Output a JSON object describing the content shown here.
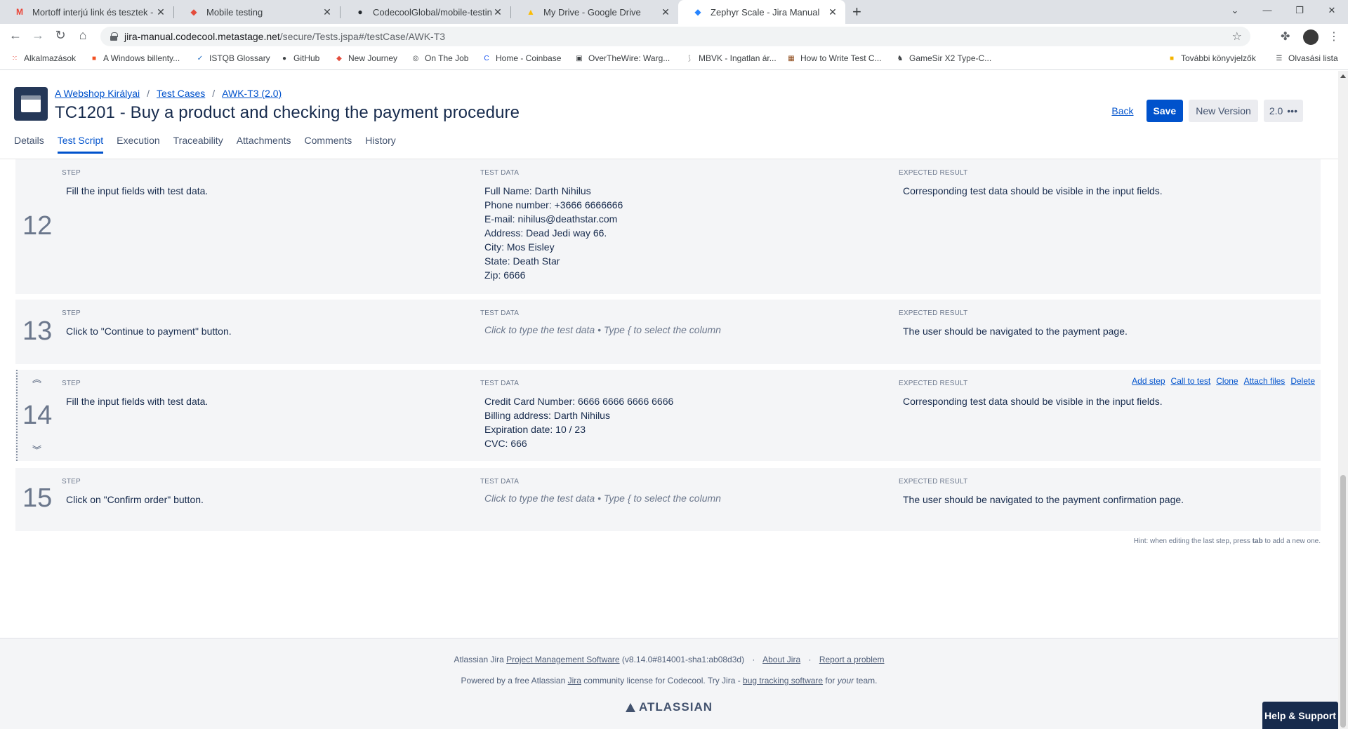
{
  "browser": {
    "tabs": [
      {
        "title": "Mortoff interjú link és tesztek - c",
        "icon": "gmail-icon"
      },
      {
        "title": "Mobile testing",
        "icon": "jira-icon"
      },
      {
        "title": "CodecoolGlobal/mobile-testing-",
        "icon": "github-icon"
      },
      {
        "title": "My Drive - Google Drive",
        "icon": "drive-icon"
      },
      {
        "title": "Zephyr Scale - Jira Manual",
        "icon": "jira-icon"
      }
    ],
    "new_tab": "+",
    "url_host": "jira-manual.codecool.metastage.net",
    "url_path": "/secure/Tests.jspa#/testCase/AWK-T3",
    "bookmarks": [
      "Alkalmazások",
      "A Windows billenty...",
      "ISTQB Glossary",
      "GitHub",
      "New Journey",
      "On The Job",
      "Home - Coinbase",
      "OverTheWire: Warg...",
      "MBVK - Ingatlan ár...",
      "How to Write Test C...",
      "GameSir X2 Type-C..."
    ],
    "other_bookmarks": "További könyvjelzők",
    "reading_list": "Olvasási lista"
  },
  "header": {
    "breadcrumbs": [
      "A Webshop Királyai",
      "Test Cases",
      "AWK-T3 (2.0)"
    ],
    "title": "TC1201 - Buy a product and checking the payment procedure",
    "back": "Back",
    "save": "Save",
    "new_version": "New Version",
    "version": "2.0",
    "tabs": [
      "Details",
      "Test Script",
      "Execution",
      "Traceability",
      "Attachments",
      "Comments",
      "History"
    ]
  },
  "labels": {
    "step": "STEP",
    "test_data": "TEST DATA",
    "expected": "EXPECTED RESULT",
    "placeholder": "Click to type the test data • Type { to select the column"
  },
  "steps": [
    {
      "num": "12",
      "step": "Fill the input fields with test data.",
      "data": "Full Name: Darth Nihilus\nPhone number: +3666 6666666\nE-mail: nihilus@deathstar.com\nAddress: Dead Jedi way 66.\nCity: Mos Eisley\nState: Death Star\nZip: 6666",
      "expected": "Corresponding test data should be visible in the input fields."
    },
    {
      "num": "13",
      "step": "Click to \"Continue to payment\" button.",
      "data": "",
      "expected": "The user should be navigated to the payment page."
    },
    {
      "num": "14",
      "step": "Fill the input fields with test data.",
      "data": "Credit Card Number: 6666 6666 6666 6666\nBilling address: Darth Nihilus\nExpiration date: 10 / 23\nCVC: 666",
      "expected": "Corresponding test data should be visible in the input fields."
    },
    {
      "num": "15",
      "step": "Click on \"Confirm order\" button.",
      "data": "",
      "expected": "The user should be navigated to the payment confirmation page."
    }
  ],
  "step_actions": [
    "Add step",
    "Call to test",
    "Clone",
    "Attach files",
    "Delete"
  ],
  "hint": {
    "pre": "Hint: when editing the last step, press ",
    "key": "tab",
    "post": " to add a new one."
  },
  "footer": {
    "l1_pre": "Atlassian Jira ",
    "l1_link": "Project Management Software",
    "l1_version": " (v8.14.0#814001-sha1:ab08d3d)",
    "about": "About Jira",
    "report": "Report a problem",
    "l2_a": "Powered by a free Atlassian ",
    "l2_jira": "Jira",
    "l2_b": " community license for Codecool. Try Jira - ",
    "l2_link": "bug tracking software",
    "l2_c": " for ",
    "l2_your": "your",
    "l2_d": " team.",
    "logo": "ATLASSIAN"
  },
  "help_button": "Help & Support",
  "colors": {
    "accent": "#0052cc",
    "step_bg": "#f4f5f7",
    "text": "#172b4d",
    "muted": "#6b778c"
  }
}
